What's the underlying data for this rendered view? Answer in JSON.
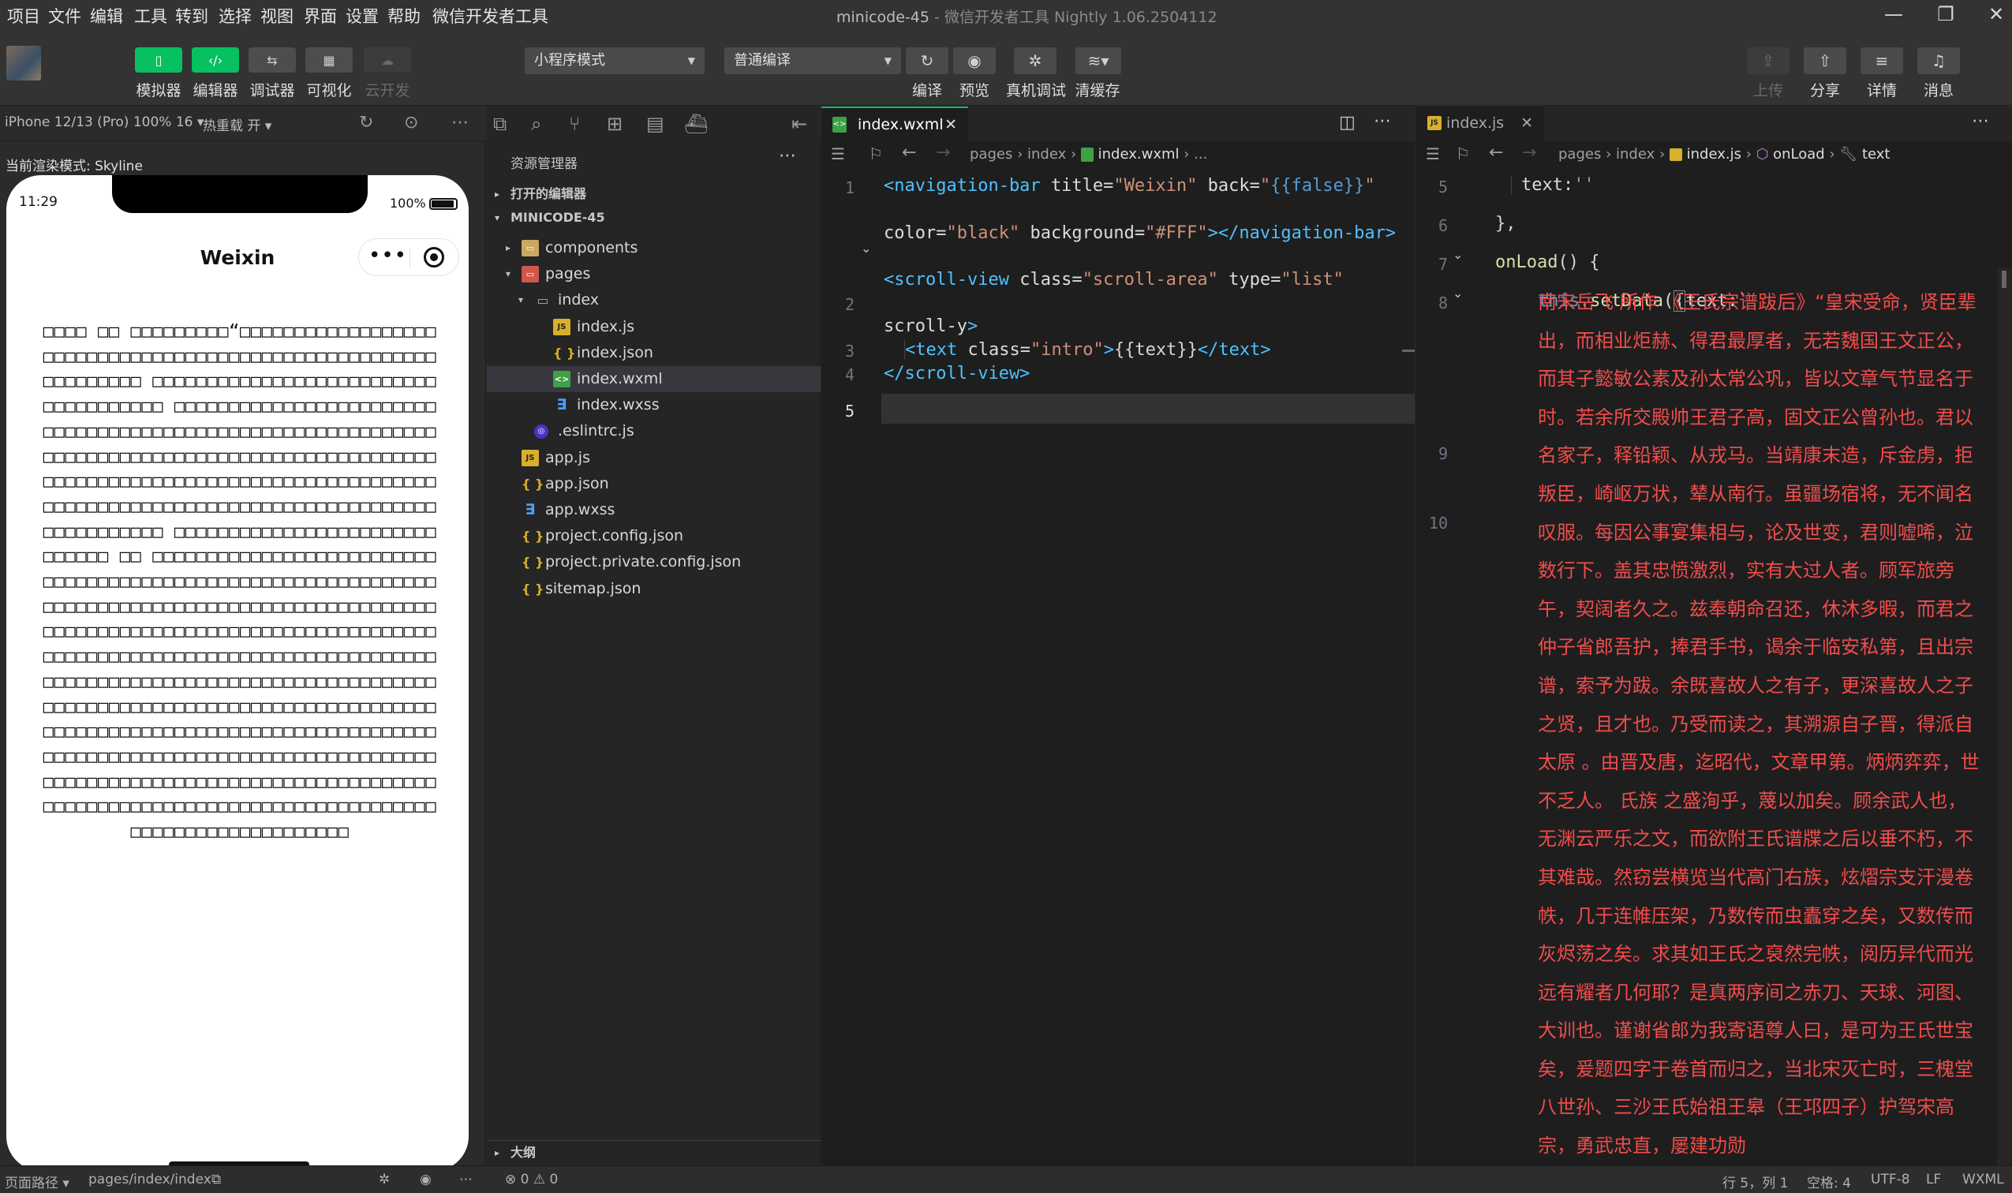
{
  "menu": [
    "项目",
    "文件",
    "编辑",
    "工具",
    "转到",
    "选择",
    "视图",
    "界面",
    "设置",
    "帮助",
    "微信开发者工具"
  ],
  "window": {
    "project": "minicode-45",
    "app": "微信开发者工具 Nightly 1.06.2504112",
    "minimize": "—",
    "restore": "❐",
    "close": "✕"
  },
  "toolbar": {
    "left": [
      {
        "label": "模拟器",
        "icon": "phone-icon"
      },
      {
        "label": "编辑器",
        "icon": "code-icon"
      },
      {
        "label": "调试器",
        "icon": "debug-icon"
      },
      {
        "label": "可视化",
        "icon": "layout-icon"
      },
      {
        "label": "云开发",
        "icon": "cloud-icon",
        "disabled": true
      }
    ],
    "mode_select": "小程序模式",
    "compile_select": "普通编译",
    "actions": [
      {
        "label": "编译",
        "icon": "refresh-icon"
      },
      {
        "label": "预览",
        "icon": "eye-icon"
      },
      {
        "label": "真机调试",
        "icon": "bug-icon"
      },
      {
        "label": "清缓存",
        "icon": "layers-icon"
      }
    ],
    "right": [
      {
        "label": "上传",
        "icon": "upload-icon",
        "disabled": true
      },
      {
        "label": "分享",
        "icon": "share-icon"
      },
      {
        "label": "详情",
        "icon": "menu-icon"
      },
      {
        "label": "消息",
        "icon": "bell-icon"
      }
    ]
  },
  "simulator": {
    "device": "iPhone 12/13 (Pro) 100% 16 ▾",
    "hot_reload": "热重载 开 ▾",
    "render_mode": "当前渲染模式: Skyline",
    "status_time": "11:29",
    "battery": "100%",
    "nav_title": "Weixin",
    "capsule_dots": "•••",
    "body_text": "□□□□ □□ □□□□□□□□□“□□□□□□□□□□□□□□□□□□□□□□□□□□□□□□□□□□□□□□□□□□□□□□□□□□□□□□□□□□□□□□□ □□□□□□□□□□□□□□□□□□□□□□□□□□□□□□□□□□□□□ □□□□□□□□□□□□□□□□□□□□□□□□□□□□□□□□□□□□□□□□□□□□□□□□□□□□□□□□□□□□□□□□□□□□□□□□□□□□□□□□□□□□□□□□□□□□□□□□□□□□□□□□□□□□□□□□□□□□□□□□□□□□□□□□□□□□□□□□□□□□□□□□□□□□□□□□□□□□□□□□□□□□□□□□□□□□□□□□□□□ □□□□□□□□□□□□□□□□□□□□□□□□□□□□□□ □□ □□□□□□□□□□□□□□□□□□□□□□□□□□□□□□□□□□□□□□□□□□□□□□□□□□□□□□□□□□□□□□□□□□□□□□□□□□□□□□□□□□□□□□□□□□□□□□□□□□□□□□□□□□□□□□□□□□□□□□□□□□□□□□□□□□□□□□□□□□□□□□□□□□□□□□□□□□□□□□□□□□□□□□□□□□□□□□□□□□□□□□□□□□□□□□□□□□□□□□□□□□□□□□□□□□□□□□□□□□□□□□□□□□□□□□□□□□□□□□□□□□□□□□□□□□□□□□□□□□□□□□□□□□□□□□□□□□□□□□□□□□□□□□□□□□□□□□□□□□□□□□□□□□□□□□□□□□□□□□□□□□□□□□□□□□□□□□□□□□□□□□□□□□□□□□□□□□□□□□□□□□□□□□□□□□□□□□□□□□□□□□□□□□□□□□□□□□□□□□□□□□□□□□"
  },
  "explorer": {
    "title": "资源管理器",
    "open_editors": "打开的编辑器",
    "project": "MINICODE-45",
    "outline": "大纲",
    "tree": [
      {
        "name": "components",
        "type": "folder",
        "depth": 1,
        "twisty": "▸"
      },
      {
        "name": "pages",
        "type": "folder-red",
        "depth": 1,
        "twisty": "▾"
      },
      {
        "name": "index",
        "type": "folder-open",
        "depth": 2,
        "twisty": "▾"
      },
      {
        "name": "index.js",
        "type": "js",
        "depth": 3
      },
      {
        "name": "index.json",
        "type": "json",
        "depth": 3
      },
      {
        "name": "index.wxml",
        "type": "wxml",
        "depth": 3,
        "selected": true
      },
      {
        "name": "index.wxss",
        "type": "wxss",
        "depth": 3
      },
      {
        "name": ".eslintrc.js",
        "type": "eslint",
        "depth": 2
      },
      {
        "name": "app.js",
        "type": "js",
        "depth": 1
      },
      {
        "name": "app.json",
        "type": "json",
        "depth": 1
      },
      {
        "name": "app.wxss",
        "type": "wxss",
        "depth": 1
      },
      {
        "name": "project.config.json",
        "type": "json",
        "depth": 1
      },
      {
        "name": "project.private.config.json",
        "type": "json",
        "depth": 1
      },
      {
        "name": "sitemap.json",
        "type": "json",
        "depth": 1
      }
    ]
  },
  "editor1": {
    "tab": "index.wxml",
    "breadcrumb": [
      "pages",
      "index",
      "index.wxml",
      "..."
    ],
    "line_numbers": [
      "1",
      "2",
      "3",
      "4",
      "5"
    ]
  },
  "editor2": {
    "tab": "index.js",
    "breadcrumb": [
      "pages",
      "index",
      "index.js",
      "onLoad",
      "text"
    ],
    "line_numbers": [
      "5",
      "6",
      "7",
      "8",
      "9",
      "10"
    ],
    "red_text": "南宋岳飞 所作 《王氏宗谱跋后》“皇宋受命，贤臣辈出，而相业炬赫、得君最厚者，无若魏国王文正公，而其子懿敏公素及孙太常公巩，皆以文章气节显名于时。若余所交殿帅王君子高，固文正公曾孙也。君以名家子，释铅颖、从戎马。当靖康末造，斥金虏，拒叛臣，崎岖万状，辇从南行。虽疆场宿将，无不闻名叹服。每因公事宴集相与，论及世变，君则嘘唏，泣数行下。盖其忠愤激烈，实有大过人者。顾军旅旁午，契阔者久之。兹奉朝命召还，休沐多暇，而君之仲子省郎吾护，捧君手书，谒余于临安私第，且出宗谱，索予为跋。余既喜故人之有子，更深喜故人之子之贤，且才也。乃受而读之，其溯源自子晋，得派自 太原 。由晋及唐，迄昭代，文章甲第。炳炳弈弈，世不乏人。 氏族 之盛洵乎，蔑以加矣。顾余武人也，无渊云严乐之文，而欲附王氏谱牒之后以垂不朽，不其难哉。然窃尝横览当代高门右族，炫熠宗支汗漫卷帙，几于连帷压架，乃数传而虫蠹穿之矣，又数传而灰烬荡之矣。求其如王氏之裒然完帙，阅历异代而光远有耀者几何耶？是真两序间之赤刀、天球、河图、大训也。谨谢省郎为我寄语尊人曰，是可为王氏世宝矣，爰题四字于卷首而归之，当北宋灭亡时，三槐堂八世孙、三沙王氏始祖王皋（王邛四子）护驾宋高宗，勇武忠直，屡建功勋"
  },
  "statusbar": {
    "path_label": "页面路径 ▾",
    "path": "pages/index/index",
    "errors": "⊗ 0 ⚠ 0",
    "position": "行 5，列 1",
    "spaces": "空格: 4",
    "encoding": "UTF-8",
    "eol": "LF",
    "language": "WXML"
  }
}
